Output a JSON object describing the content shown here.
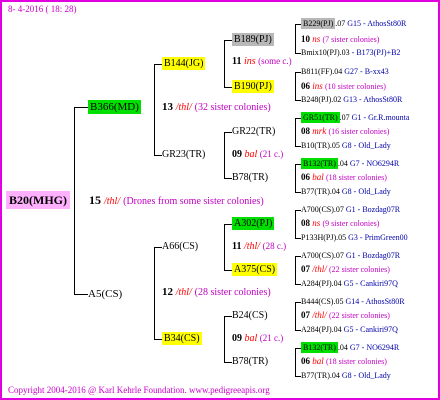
{
  "header": "8- 4-2016 ( 18: 28)",
  "footer": "Copyright 2004-2016 @ Karl Kehrle Foundation.   www.pedigreeapis.org",
  "root": {
    "name": "B20(MHG)",
    "num": "15",
    "sym": "/thl/",
    "note": "(Drones from some sister colonies)"
  },
  "g2_top": {
    "name": "B366(MD)",
    "num": "13",
    "sym": "/thl/",
    "note": "(32 sister colonies)"
  },
  "g2_bot": {
    "name": "A5(CS)",
    "num": "12",
    "sym": "/thl/",
    "note": "(28 sister colonies)"
  },
  "g3": [
    {
      "name": "B144(JG)",
      "num": "11",
      "sym": "ins",
      "note": "(some c.)"
    },
    {
      "name": "GR23(TR)",
      "num": "09",
      "sym": "bal",
      "note": "(21 c.)"
    },
    {
      "name": "A66(CS)",
      "num": "11",
      "sym": "/thl/",
      "note": "(28 c.)"
    },
    {
      "name": "B34(CS)",
      "num": "09",
      "sym": "bal",
      "note": "(21 c.)"
    }
  ],
  "g4": [
    {
      "name": "B189(PJ)",
      "num": "10",
      "sym": "ns",
      "note": "(7 sister colonies)"
    },
    {
      "name": "B190(PJ)",
      "num": "06",
      "sym": "ins",
      "note": "(10 sister colonies)"
    },
    {
      "name": "GR22(TR)",
      "num": "08",
      "sym": "mrk",
      "note": "(16 sister colonies)"
    },
    {
      "name": "B78(TR)",
      "num": "06",
      "sym": "bal",
      "note": "(18 sister colonies)"
    },
    {
      "name": "A302(PJ)",
      "num": "08",
      "sym": "ns",
      "note": "(9 sister colonies)"
    },
    {
      "name": "A375(CS)",
      "num": "07",
      "sym": "/thl/",
      "note": "(22 sister colonies)"
    },
    {
      "name": "B24(CS)",
      "num": "07",
      "sym": "/thl/",
      "note": "(22 sister colonies)"
    },
    {
      "name": "B78(TR)",
      "num": "06",
      "sym": "bal",
      "note": "(18 sister colonies)"
    }
  ],
  "g5": [
    {
      "name": "B229(PJ)",
      "yr": ".07",
      "src": "G15 - AthosSt80R"
    },
    {
      "name": "Bmix10(PJ)",
      "yr": ".03",
      "src": "- B173(PJ)+B2"
    },
    {
      "name": "B811(FF)",
      "yr": ".04",
      "src": "G27 - B-xx43"
    },
    {
      "name": "B248(PJ)",
      "yr": ".02",
      "src": "G13 - AthosSt80R"
    },
    {
      "name": "GR51(TR)",
      "yr": ".07",
      "src": "G1 - Gr.R.mounta"
    },
    {
      "name": "B10(TR)",
      "yr": ".05",
      "src": "G8 - Old_Lady"
    },
    {
      "name": "B132(TR)",
      "yr": ".04",
      "src": "G7 - NO6294R"
    },
    {
      "name": "B77(TR)",
      "yr": ".04",
      "src": "G8 - Old_Lady"
    },
    {
      "name": "A700(CS)",
      "yr": ".07",
      "src": "G1 - Bozdag07R"
    },
    {
      "name": "P133H(PJ)",
      "yr": ".05",
      "src": "G3 - PrimGreen00"
    },
    {
      "name": "A700(CS)",
      "yr": ".07",
      "src": "G1 - Bozdag07R"
    },
    {
      "name": "A284(PJ)",
      "yr": ".04",
      "src": "G5 - Cankiri97Q"
    },
    {
      "name": "B444(CS)",
      "yr": ".05",
      "src": "G14 - AthosSt80R"
    },
    {
      "name": "A284(PJ)",
      "yr": ".04",
      "src": "G5 - Cankiri97Q"
    },
    {
      "name": "B132(TR)",
      "yr": ".04",
      "src": "G7 - NO6294R"
    },
    {
      "name": "B77(TR)",
      "yr": ".04",
      "src": "G8 - Old_Lady"
    }
  ]
}
